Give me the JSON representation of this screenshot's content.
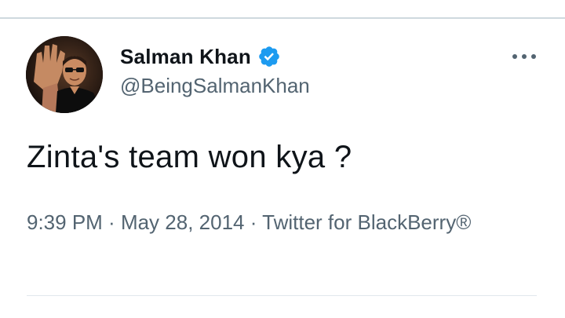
{
  "tweet": {
    "author": {
      "display_name": "Salman Khan",
      "handle": "@BeingSalmanKhan",
      "verified": true
    },
    "text": "Zinta's team won kya ?",
    "timestamp": {
      "time": "9:39 PM",
      "separator": " · ",
      "date": "May 28, 2014",
      "source": "Twitter for BlackBerry®"
    }
  },
  "icons": {
    "verified": "verified-badge-icon",
    "more": "more-options-icon"
  },
  "colors": {
    "verified_blue": "#1d9bf0",
    "text_primary": "#0f1419",
    "text_secondary": "#536471",
    "divider": "#cfd9de"
  }
}
